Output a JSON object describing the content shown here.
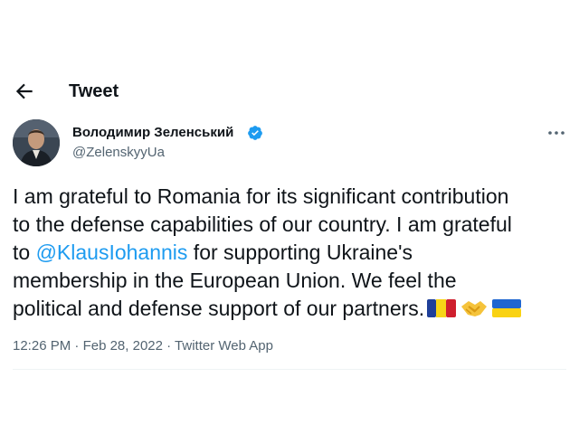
{
  "header": {
    "title": "Tweet",
    "back_icon": "arrow-left-icon"
  },
  "author": {
    "display_name": "Володимир Зеленський",
    "handle": "@ZelenskyyUa",
    "verified_icon": "verified-badge-icon",
    "more_icon": "more-horizontal-icon"
  },
  "tweet": {
    "line1": "I am grateful to Romania for its significant contribution",
    "line2": "to the defense capabilities of our country. I am grateful",
    "line3_prefix": "to ",
    "mention": "@KlausIohannis",
    "line3_suffix": " for supporting Ukraine's",
    "line4": "membership in the European Union. We feel the",
    "line5": "political and defense support of our partners.",
    "emojis": [
      "flag-romania",
      "handshake",
      "flag-ukraine"
    ]
  },
  "meta": {
    "time": "12:26 PM",
    "sep1": " · ",
    "date": "Feb 28, 2022",
    "sep2": " · ",
    "source": "Twitter Web App"
  },
  "colors": {
    "accent": "#1d9bf0",
    "text": "#0f1419",
    "secondary": "#536471"
  }
}
